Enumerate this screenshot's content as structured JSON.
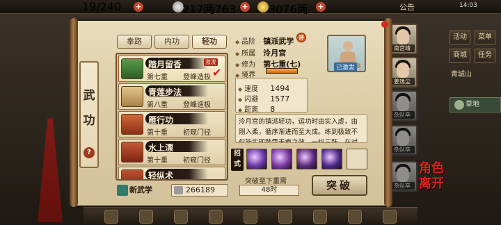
{
  "topbar": {
    "stamina": "19/240",
    "silver": "217两763文",
    "gold": "3076两",
    "notice": "公告",
    "clock": "14:03"
  },
  "side_title": "武功",
  "tabs": [
    "拳路",
    "内功",
    "轻功"
  ],
  "skills": [
    {
      "name": "踏月留香",
      "level": "第七重",
      "rank": "登峰造极",
      "tag": "激发",
      "selected": true,
      "icon_color": "#3e7e3a"
    },
    {
      "name": "青莲步法",
      "level": "第八重",
      "rank": "登峰造极",
      "tag": "",
      "selected": false,
      "icon_color": "#c9a46a"
    },
    {
      "name": "雁行功",
      "level": "第十重",
      "rank": "初窥门径",
      "tag": "",
      "selected": false,
      "icon_color": "#b24a2a"
    },
    {
      "name": "水上漂",
      "level": "第十重",
      "rank": "初窥门径",
      "tag": "",
      "selected": false,
      "icon_color": "#a23a24"
    },
    {
      "name": "轻纵术",
      "level": "",
      "rank": "",
      "tag": "",
      "selected": false,
      "icon_color": "#9a3424"
    }
  ],
  "new_skill_label": "新武学",
  "coins": "266189",
  "detail": {
    "grade_label": "品阶",
    "grade_value": "镇派武学",
    "grade_badge": "评",
    "school_label": "所属",
    "school_value": "泠月宫",
    "cultivation_label": "修为",
    "cultivation_value": "第七重(七)",
    "realm_label": "境界",
    "realm_fill": 1.0,
    "avatar_label": "已激发",
    "stats": [
      {
        "label": "速度",
        "value": "1494"
      },
      {
        "label": "闪避",
        "value": "1577"
      },
      {
        "label": "距离",
        "value": "8"
      }
    ],
    "description": "泠月宫的镇派轻功，运功时由实入虚，由刚入柔，循序渐进而至大成。练到极致不仅能实现踏雪无痕之效，一纵三跃，在对战中更是变幻莫测，能于瞬息间变换身位令敌无从应对。",
    "moves_label": "招式",
    "moves_colors": [
      "#6a3aa8",
      "#7a3aa0",
      "#5a2a7a",
      "#4a2a8a"
    ],
    "progress_label": "突破至下重需",
    "time_needed": "48时",
    "break_button": "突破"
  },
  "right_buttons": [
    "活动",
    "菜单",
    "商城",
    "任务"
  ],
  "location": "青城山",
  "map_label": "草地",
  "portraits": [
    {
      "name": "南宫靖",
      "dim": false
    },
    {
      "name": "姜逸尘",
      "dim": false
    },
    {
      "name": "杂队卒",
      "dim": true
    },
    {
      "name": "杂队卒",
      "dim": true
    },
    {
      "name": "杂队卒",
      "dim": true
    }
  ],
  "seal_text": "角色 离开"
}
